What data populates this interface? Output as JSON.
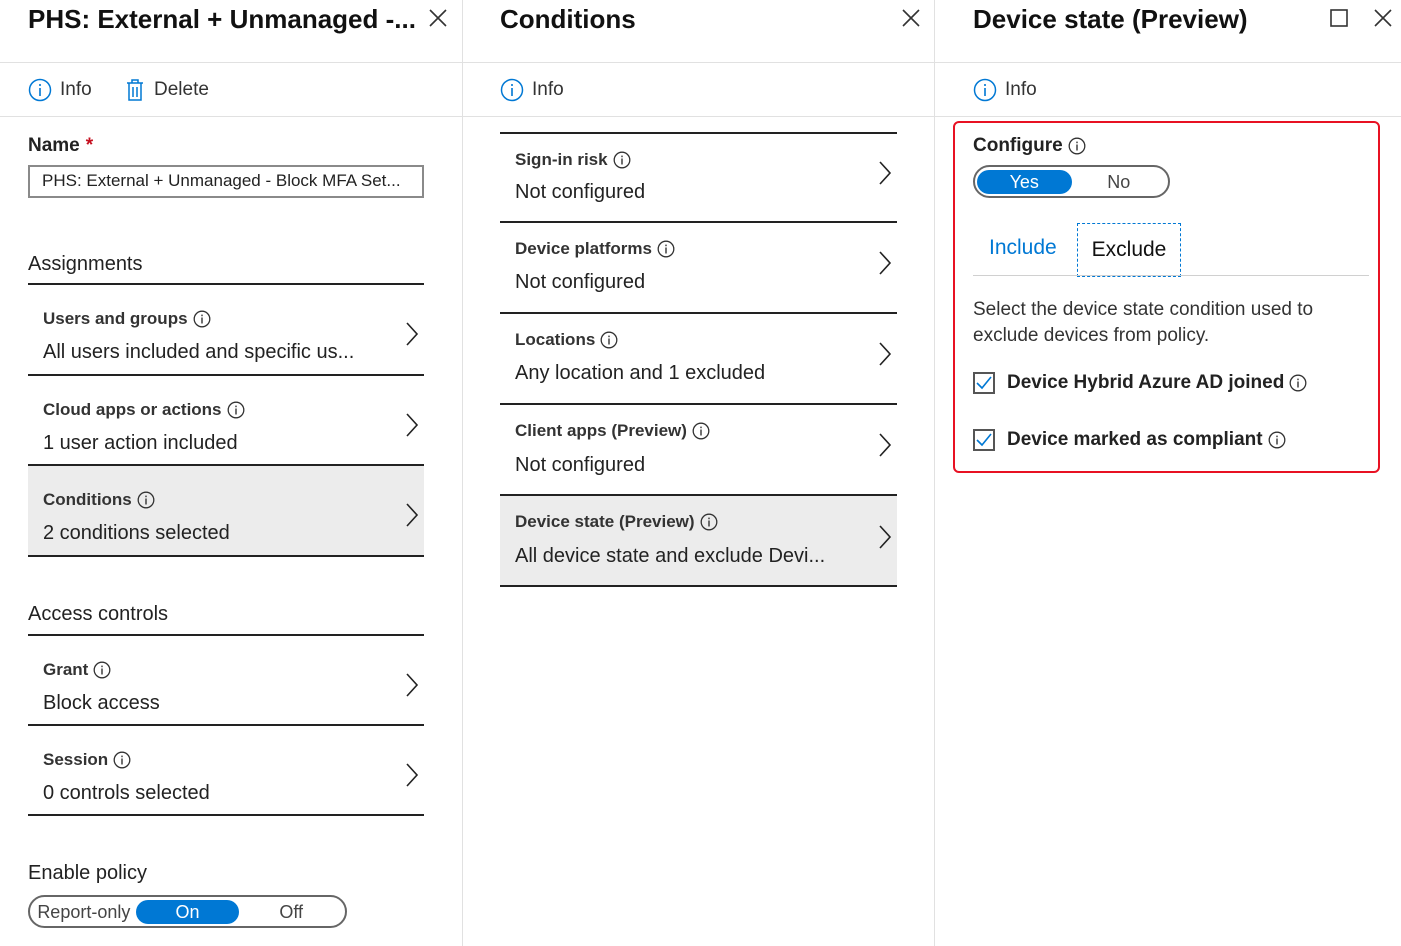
{
  "blade1": {
    "title": "PHS: External + Unmanaged -...",
    "toolbar": {
      "info": "Info",
      "delete": "Delete"
    },
    "name_label": "Name",
    "required_mark": "*",
    "name_value": "PHS: External + Unmanaged - Block MFA Set...",
    "assignments": {
      "title": "Assignments",
      "items": [
        {
          "name": "Users and groups",
          "value": "All users included and specific us..."
        },
        {
          "name": "Cloud apps or actions",
          "value": "1 user action included"
        },
        {
          "name": "Conditions",
          "value": "2 conditions selected"
        }
      ]
    },
    "access_controls": {
      "title": "Access controls",
      "items": [
        {
          "name": "Grant",
          "value": "Block access"
        },
        {
          "name": "Session",
          "value": "0 controls selected"
        }
      ]
    },
    "enable_policy": {
      "title": "Enable policy",
      "options": [
        "Report-only",
        "On",
        "Off"
      ],
      "selected": "On"
    }
  },
  "blade2": {
    "title": "Conditions",
    "toolbar": {
      "info": "Info"
    },
    "items": [
      {
        "name": "Sign-in risk",
        "value": "Not configured"
      },
      {
        "name": "Device platforms",
        "value": "Not configured"
      },
      {
        "name": "Locations",
        "value": "Any location and 1 excluded"
      },
      {
        "name": "Client apps (Preview)",
        "value": "Not configured"
      },
      {
        "name": "Device state (Preview)",
        "value": "All device state and exclude Devi..."
      }
    ]
  },
  "blade3": {
    "title": "Device state (Preview)",
    "toolbar": {
      "info": "Info"
    },
    "configure_label": "Configure",
    "configure_options": [
      "Yes",
      "No"
    ],
    "configure_selected": "Yes",
    "tabs": [
      "Include",
      "Exclude"
    ],
    "active_tab": "Exclude",
    "description_line1": "Select the device state condition used to",
    "description_line2": "exclude devices from policy.",
    "checkboxes": [
      {
        "label": "Device Hybrid Azure AD joined",
        "checked": true
      },
      {
        "label": "Device marked as compliant",
        "checked": true
      }
    ]
  },
  "colors": {
    "accent": "#0078d4",
    "highlight": "#e81123",
    "selected_row": "#ececec"
  }
}
